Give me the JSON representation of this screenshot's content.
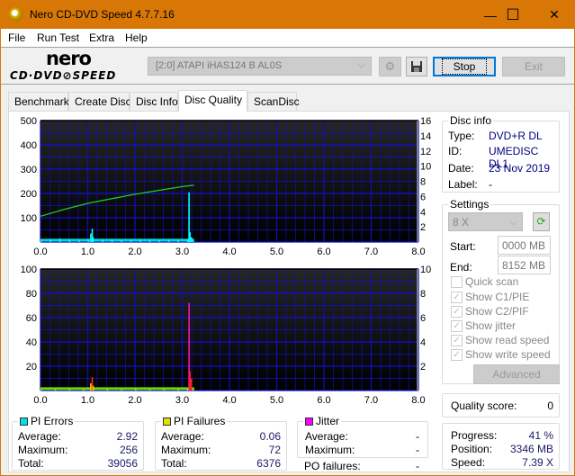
{
  "window": {
    "title": "Nero CD-DVD Speed 4.7.7.16",
    "controls": {
      "minimize": "—",
      "maximize": "☐",
      "close": "✕"
    }
  },
  "menu": [
    {
      "label": "File",
      "accel": "F"
    },
    {
      "label": "Run Test",
      "accel": "R"
    },
    {
      "label": "Extra",
      "accel": "E"
    },
    {
      "label": "Help",
      "accel": "H"
    }
  ],
  "toolbar": {
    "logo_top": "nero",
    "logo_bottom": "CD·DVD⊘SPEED",
    "drive": "[2:0]   ATAPI iHAS124   B AL0S",
    "stop_label": "Stop",
    "exit_label": "Exit"
  },
  "tabs": [
    "Benchmark",
    "Create Disc",
    "Disc Info",
    "Disc Quality",
    "ScanDisc"
  ],
  "active_tab": "Disc Quality",
  "disc_info": {
    "title": "Disc info",
    "type_label": "Type:",
    "type": "DVD+R DL",
    "id_label": "ID:",
    "id": "UMEDISC DL1",
    "date_label": "Date:",
    "date": "23 Nov 2019",
    "label_label": "Label:",
    "label": "-"
  },
  "settings": {
    "title": "Settings",
    "speed": "8 X",
    "start_label": "Start:",
    "start": "0000 MB",
    "end_label": "End:",
    "end": "8152 MB",
    "quick_scan": "Quick scan",
    "show_c1": "Show C1/PIE",
    "show_c2": "Show C2/PIF",
    "show_jitter": "Show jitter",
    "show_read": "Show read speed",
    "show_write": "Show write speed",
    "advanced": "Advanced"
  },
  "quality": {
    "label": "Quality score:",
    "value": "0"
  },
  "progress": {
    "progress_label": "Progress:",
    "progress": "41 %",
    "position_label": "Position:",
    "position": "3346 MB",
    "speed_label": "Speed:",
    "speed": "7.39 X"
  },
  "pi_errors": {
    "title": "PI Errors",
    "color": "#00e0e0",
    "average": "2.92",
    "maximum": "256",
    "total": "39056"
  },
  "pi_failures": {
    "title": "PI Failures",
    "color": "#e0e000",
    "average": "0.06",
    "maximum": "72",
    "total": "6376"
  },
  "jitter": {
    "title": "Jitter",
    "color": "#ff00ff",
    "average": "-",
    "maximum": "-"
  },
  "po_failures": {
    "label": "PO failures:",
    "value": "-"
  },
  "stat_labels": {
    "average": "Average:",
    "maximum": "Maximum:",
    "total": "Total:"
  },
  "chart_data": [
    {
      "type": "bar",
      "title": "PI Errors",
      "x_ticks": [
        "0.0",
        "1.0",
        "2.0",
        "3.0",
        "4.0",
        "5.0",
        "6.0",
        "7.0",
        "8.0"
      ],
      "xlim": [
        0,
        8
      ],
      "ylim": [
        0,
        500
      ],
      "y_ticks": [
        "500",
        "400",
        "300",
        "200",
        "100"
      ],
      "y2lim": [
        0,
        16
      ],
      "y2_ticks": [
        "16",
        "14",
        "12",
        "10",
        "8",
        "6",
        "4",
        "2"
      ],
      "grid": true,
      "series": [
        {
          "name": "PI Errors",
          "color": "#00ffff",
          "x": [
            0.0,
            0.2,
            0.4,
            0.6,
            0.8,
            1.0,
            1.05,
            1.08,
            1.1,
            1.3,
            1.5,
            1.7,
            1.9,
            2.1,
            2.3,
            2.5,
            2.7,
            2.9,
            3.1,
            3.13,
            3.15,
            3.18,
            3.22
          ],
          "values": [
            10,
            12,
            14,
            10,
            8,
            12,
            35,
            55,
            20,
            10,
            12,
            8,
            10,
            12,
            10,
            8,
            10,
            10,
            12,
            205,
            40,
            20,
            12
          ]
        },
        {
          "name": "Read speed",
          "color": "#22cc22",
          "axis": "y2",
          "x": [
            0.0,
            0.5,
            1.0,
            1.5,
            2.0,
            2.5,
            3.0,
            3.25
          ],
          "values": [
            3.4,
            4.3,
            5.1,
            5.7,
            6.3,
            6.8,
            7.3,
            7.5
          ]
        }
      ]
    },
    {
      "type": "bar",
      "title": "PI Failures",
      "x_ticks": [
        "0.0",
        "1.0",
        "2.0",
        "3.0",
        "4.0",
        "5.0",
        "6.0",
        "7.0",
        "8.0"
      ],
      "xlim": [
        0,
        8
      ],
      "ylim": [
        0,
        100
      ],
      "y_ticks": [
        "100",
        "80",
        "60",
        "40",
        "20"
      ],
      "y2lim": [
        0,
        10
      ],
      "y2_ticks": [
        "10",
        "8",
        "6",
        "4",
        "2"
      ],
      "grid": true,
      "series": [
        {
          "name": "PI Failures",
          "color": "#80ff00",
          "x": [
            0.0,
            0.3,
            0.6,
            0.9,
            1.05,
            1.08,
            1.1,
            1.4,
            1.7,
            2.0,
            2.3,
            2.6,
            2.9,
            3.1,
            3.13,
            3.15,
            3.18,
            3.22
          ],
          "values": [
            1,
            1,
            1,
            1,
            6,
            11,
            4,
            1,
            1,
            1,
            1,
            1,
            1,
            2,
            72,
            16,
            10,
            2
          ]
        }
      ]
    }
  ]
}
